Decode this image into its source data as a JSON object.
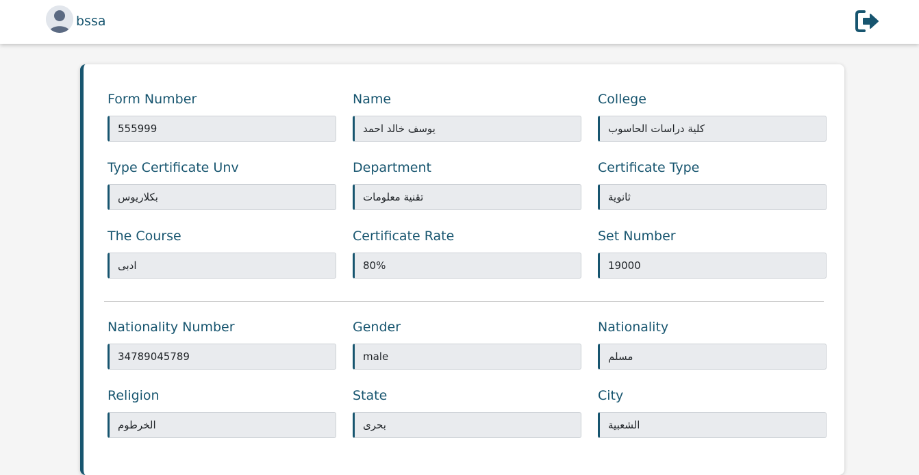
{
  "header": {
    "username": "bssa",
    "icons": {
      "avatar": "user-avatar-icon",
      "logout": "logout-icon"
    },
    "accent_color": "#17556f"
  },
  "form": {
    "row1": [
      {
        "label": "Form Number",
        "value": "555999"
      },
      {
        "label": "Name",
        "value": "يوسف خالد احمد"
      },
      {
        "label": "College",
        "value": "كلية دراسات الحاسوب"
      }
    ],
    "row2": [
      {
        "label": "Type Certificate Unv",
        "value": "بكلاريوس"
      },
      {
        "label": "Department",
        "value": "تقنية معلومات"
      },
      {
        "label": "Certificate Type",
        "value": "ثانوية"
      }
    ],
    "row3": [
      {
        "label": "The Course",
        "value": "ادبى"
      },
      {
        "label": "Certificate Rate",
        "value": "80%"
      },
      {
        "label": "Set Number",
        "value": "19000"
      }
    ],
    "row4": [
      {
        "label": "Nationality Number",
        "value": "34789045789"
      },
      {
        "label": "Gender",
        "value": "male"
      },
      {
        "label": "Nationality",
        "value": "مسلم"
      }
    ],
    "row5": [
      {
        "label": "Religion",
        "value": "الخرطوم"
      },
      {
        "label": "State",
        "value": "بحرى"
      },
      {
        "label": "City",
        "value": "الشعبية"
      }
    ]
  }
}
